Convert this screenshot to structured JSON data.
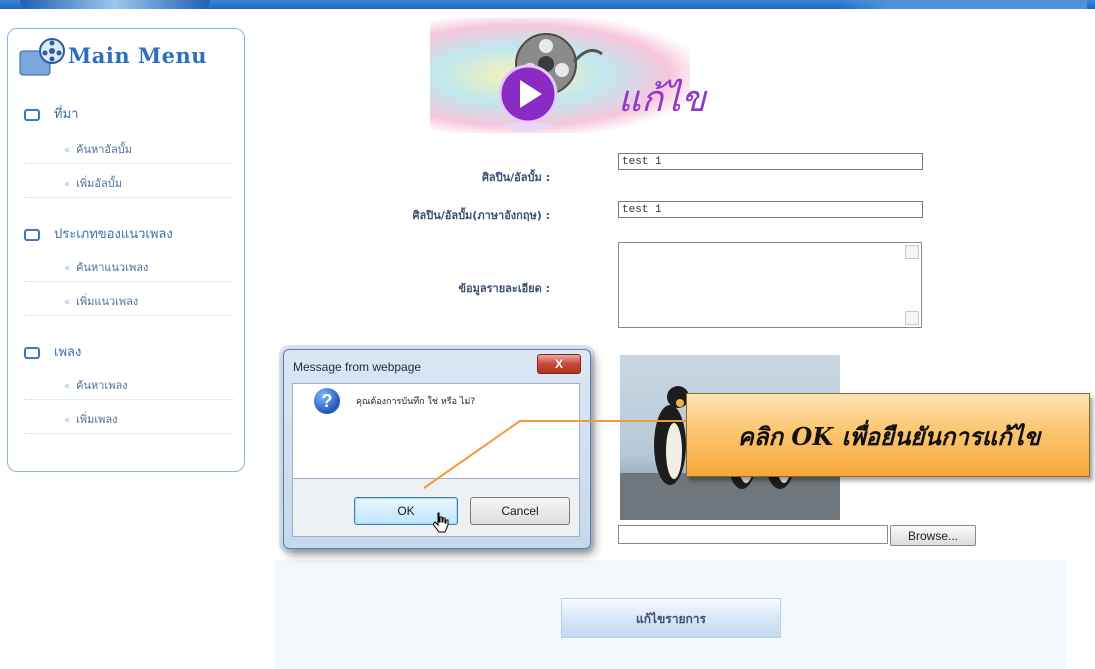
{
  "sidebar": {
    "title": "Main Menu",
    "sections": [
      {
        "label": "ที่มา",
        "items": [
          "ค้นหาอัลบั้ม",
          "เพิ่มอัลบั้ม"
        ]
      },
      {
        "label": "ประเภทของแนวเพลง",
        "items": [
          "ค้นหาแนวเพลง",
          "เพิ่มแนวเพลง"
        ]
      },
      {
        "label": "เพลง",
        "items": [
          "ค้นหาเพลง",
          "เพิ่มเพลง"
        ]
      }
    ]
  },
  "banner": {
    "title": "แก้ไข"
  },
  "form": {
    "artist_label": "ศิลปิน/อัลบั้ม :",
    "artist_value": "test 1",
    "artist_en_label": "ศิลปิน/อัลบั้ม(ภาษาอังกฤษ) :",
    "artist_en_value": "test 1",
    "detail_label": "ข้อมูลรายละเอียด :",
    "browse_label": "Browse...",
    "submit_label": "แก้ไขรายการ"
  },
  "dialog": {
    "title": "Message from webpage",
    "close_label": "X",
    "message": "คุณต้องการบันทึก ใช่ หรือ ไม่?",
    "ok_label": "OK",
    "cancel_label": "Cancel"
  },
  "callout": {
    "text": "คลิก OK เพื่อยืนยันการแก้ไข"
  },
  "colors": {
    "accent": "#2d6fbf",
    "callout": "#f6a83a",
    "title_purple": "#8e39c9"
  }
}
